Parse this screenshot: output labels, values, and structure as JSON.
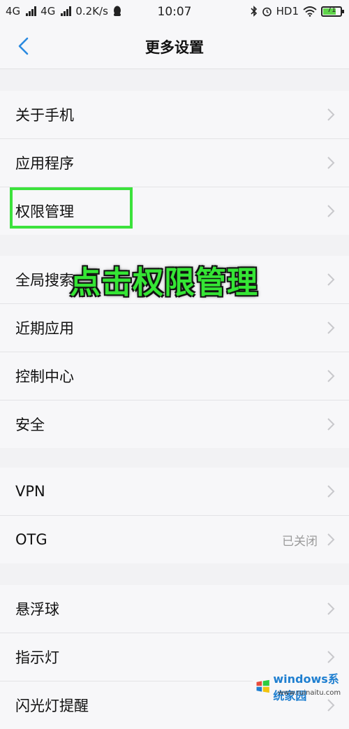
{
  "status_bar": {
    "net1": "4G",
    "net2": "4G",
    "speed": "0.2K/s",
    "time": "10:07",
    "hd": "HD1",
    "battery_level": "71"
  },
  "header": {
    "title": "更多设置"
  },
  "groups": [
    {
      "items": [
        {
          "label": "关于手机"
        },
        {
          "label": "应用程序"
        },
        {
          "label": "权限管理"
        }
      ]
    },
    {
      "items": [
        {
          "label": "全局搜索"
        },
        {
          "label": "近期应用"
        },
        {
          "label": "控制中心"
        },
        {
          "label": "安全"
        }
      ]
    },
    {
      "items": [
        {
          "label": "VPN"
        },
        {
          "label": "OTG",
          "value": "已关闭"
        }
      ]
    },
    {
      "items": [
        {
          "label": "悬浮球"
        },
        {
          "label": "指示灯"
        },
        {
          "label": "闪光灯提醒"
        }
      ]
    }
  ],
  "annotation": {
    "text": "点击权限管理",
    "color": "#35e535"
  },
  "watermark": {
    "brand": "windows系统家园",
    "sub": "www.ruinaitu.com"
  }
}
